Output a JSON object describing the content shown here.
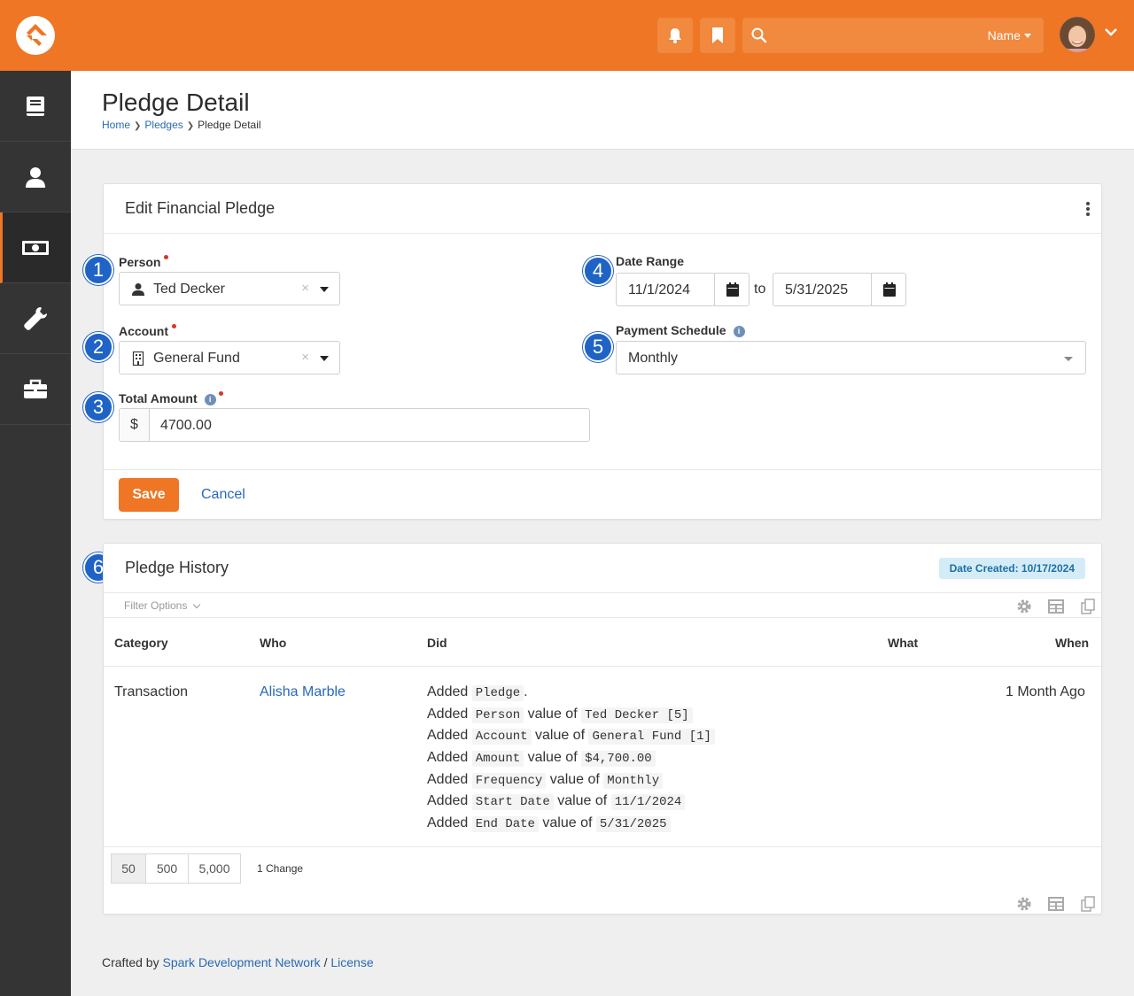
{
  "header": {
    "search_placeholder": "",
    "search_scope": "Name",
    "icons": [
      "logo-icon",
      "bell-icon",
      "bookmark-icon",
      "search-icon",
      "chevron-down-icon"
    ]
  },
  "sidebar": {
    "items": [
      {
        "icon": "book-icon"
      },
      {
        "icon": "person-icon"
      },
      {
        "icon": "money-icon",
        "active": true
      },
      {
        "icon": "wrench-icon"
      },
      {
        "icon": "briefcase-icon"
      }
    ]
  },
  "page": {
    "title": "Pledge Detail",
    "breadcrumb": [
      "Home",
      "Pledges",
      "Pledge Detail"
    ]
  },
  "edit_panel": {
    "title": "Edit Financial Pledge",
    "person_label": "Person",
    "person_value": "Ted Decker",
    "account_label": "Account",
    "account_value": "General Fund",
    "total_label": "Total Amount",
    "currency": "$",
    "total_value": "4700.00",
    "date_range_label": "Date Range",
    "start_date": "11/1/2024",
    "to_text": "to",
    "end_date": "5/31/2025",
    "schedule_label": "Payment Schedule",
    "schedule_value": "Monthly",
    "save_label": "Save",
    "cancel_label": "Cancel"
  },
  "callouts": [
    "1",
    "2",
    "3",
    "4",
    "5",
    "6"
  ],
  "history": {
    "title": "Pledge History",
    "date_created": "Date Created: 10/17/2024",
    "filter_label": "Filter Options",
    "columns": [
      "Category",
      "Who",
      "Did",
      "What",
      "When"
    ],
    "row": {
      "category": "Transaction",
      "who": "Alisha Marble",
      "when": "1 Month Ago",
      "did": [
        {
          "verb": "Added",
          "field": "Pledge",
          "mid": ".",
          "value": ""
        },
        {
          "verb": "Added",
          "field": "Person",
          "mid": "value of",
          "value": "Ted Decker [5]"
        },
        {
          "verb": "Added",
          "field": "Account",
          "mid": "value of",
          "value": "General Fund [1]"
        },
        {
          "verb": "Added",
          "field": "Amount",
          "mid": "value of",
          "value": "$4,700.00"
        },
        {
          "verb": "Added",
          "field": "Frequency",
          "mid": "value of",
          "value": "Monthly"
        },
        {
          "verb": "Added",
          "field": "Start Date",
          "mid": "value of",
          "value": "11/1/2024"
        },
        {
          "verb": "Added",
          "field": "End Date",
          "mid": "value of",
          "value": "5/31/2025"
        }
      ]
    },
    "page_sizes": [
      "50",
      "500",
      "5,000"
    ],
    "change_count": "1 Change"
  },
  "footer": {
    "prefix": "Crafted by",
    "org": "Spark Development Network",
    "sep": "/",
    "license": "License"
  },
  "colors": {
    "brand": "#ee7624",
    "sidebar": "#343434",
    "link": "#2769b7",
    "callout": "#1f63c6"
  }
}
